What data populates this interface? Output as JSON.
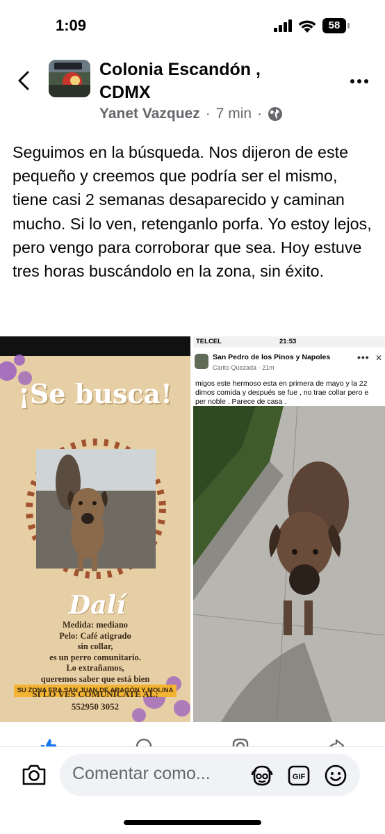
{
  "status_bar": {
    "time": "1:09",
    "battery_level": "58"
  },
  "header": {
    "title": "Colonia Escandón , CDMX",
    "author": "Yanet Vazquez",
    "separator": "·",
    "time_ago": "7 min",
    "visibility_icon": "globe-icon",
    "back_icon": "chevron-left-icon",
    "more_icon": "more-horizontal-icon"
  },
  "post": {
    "text": "Seguimos en la búsqueda. Nos dijeron de este pequeño y creemos que podría ser el mismo, tiene casi 2 semanas desaparecido y caminan mucho. Si lo ven, retenganlo porfa. Yo estoy lejos, pero vengo para corroborar que sea. Hoy estuve tres horas buscándolo en la zona, sin éxito."
  },
  "photo_left": {
    "headline": "¡Se busca!",
    "dog_name": "Dalí",
    "lines": [
      "Medida: mediano",
      "Pelo: Café atigrado",
      "sin collar,",
      "es un perro comunitario.",
      "Lo extrañamos,",
      "queremos saber que está bien"
    ],
    "zone": "SU ZONA ERA SAN JUAN DE ARAGÓN Y MOLINA",
    "contact_label": "SI LO VES COMUNÍCATE AL:",
    "phone": "552950 3052"
  },
  "photo_right": {
    "carrier": "TELCEL",
    "clock": "21:53",
    "group_name": "San Pedro de los Pinos y Napoles",
    "author": "Carito Quezada",
    "time_ago": "21m",
    "text_lines": [
      "migos este hermoso esta en primera de mayo y la 22",
      "dimos comida y después se fue , no trae collar pero e",
      "per noble . Parece de casa ."
    ]
  },
  "actions": {
    "icons": [
      "like-icon",
      "comment-icon",
      "instagram-icon",
      "share-icon"
    ]
  },
  "comment_bar": {
    "placeholder": "Comentar como...",
    "icons": [
      "camera-icon",
      "avatar-sticker-icon",
      "gif-icon",
      "emoji-icon"
    ]
  },
  "colors": {
    "brand_blue": "#1877f2",
    "secondary_text": "#65676b",
    "flyer_background": "#e7cfa5",
    "flyer_paws": "#9b5fc0"
  }
}
